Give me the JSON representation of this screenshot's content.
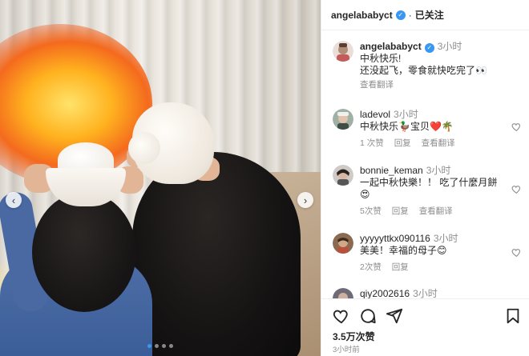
{
  "post": {
    "username": "angelababyct",
    "follow_label": "已关注",
    "caption_user": "angelababyct",
    "caption_time": "3小时",
    "caption_line1": "中秋快乐!",
    "caption_line2": "还没起飞，零食就快吃完了👀",
    "translate_label": "查看翻译",
    "likes": "3.5万次赞",
    "posted_time": "3小时前"
  },
  "comments": [
    {
      "user": "ladevol",
      "time": "3小时",
      "text": "中秋快乐🦆宝贝❤️🌴",
      "likes": "1 次赞",
      "reply": "回复",
      "translate": "查看翻译"
    },
    {
      "user": "bonnie_keman",
      "time": "3小时",
      "text": "一起中秋快樂！！ 吃了什麼月餅",
      "text2": "😍",
      "likes": "5次赞",
      "reply": "回复",
      "translate": "查看翻译"
    },
    {
      "user": "yyyyyttkx090116",
      "time": "3小时",
      "text": "美美！幸福的母子😊",
      "likes": "2次赞",
      "reply": "回复"
    },
    {
      "user": "qiy2002616",
      "time": "3小时"
    }
  ],
  "icons": {
    "like": "heart-icon",
    "comment": "comment-icon",
    "share": "send-icon",
    "save": "bookmark-icon",
    "prev": "chevron-left-icon",
    "next": "chevron-right-icon",
    "verified": "verified-badge-icon"
  },
  "colors": {
    "verified": "#3897f0",
    "text": "#262626",
    "muted": "#8e8e8e",
    "heart_red": "#ed4956"
  },
  "carousel": {
    "count": 4,
    "active_index": 0
  },
  "nav": {
    "prev": "‹",
    "next": "›"
  },
  "verified_glyph": "✓"
}
